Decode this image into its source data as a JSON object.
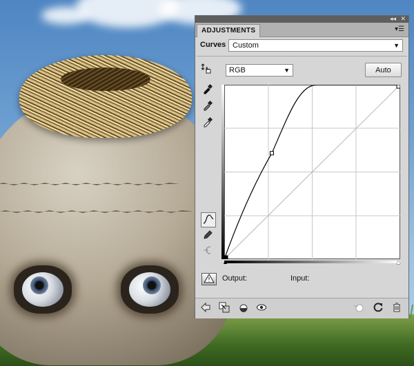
{
  "panel": {
    "title_controls": {
      "collapse": "◂◂",
      "close": "✕"
    },
    "tab_label": "ADJUSTMENTS",
    "menu_icon": "panel-menu-icon",
    "curves_label": "Curves",
    "preset_value": "Custom",
    "channel_value": "RGB",
    "auto_label": "Auto",
    "output_label": "Output:",
    "input_label": "Input:"
  },
  "tools": [
    "on-image-adjust-icon",
    "black-eyedropper-icon",
    "gray-eyedropper-icon",
    "white-eyedropper-icon",
    "curve-point-icon",
    "pencil-icon",
    "smooth-icon"
  ],
  "footer_icons": [
    "back-arrow-icon",
    "clip-layer-icon",
    "view-previous-icon",
    "visibility-eye-icon",
    "reset-previous-icon",
    "reset-default-icon",
    "trash-icon"
  ],
  "curve": {
    "points": [
      [
        0,
        0
      ],
      [
        69,
        155
      ],
      [
        255,
        255
      ]
    ]
  }
}
